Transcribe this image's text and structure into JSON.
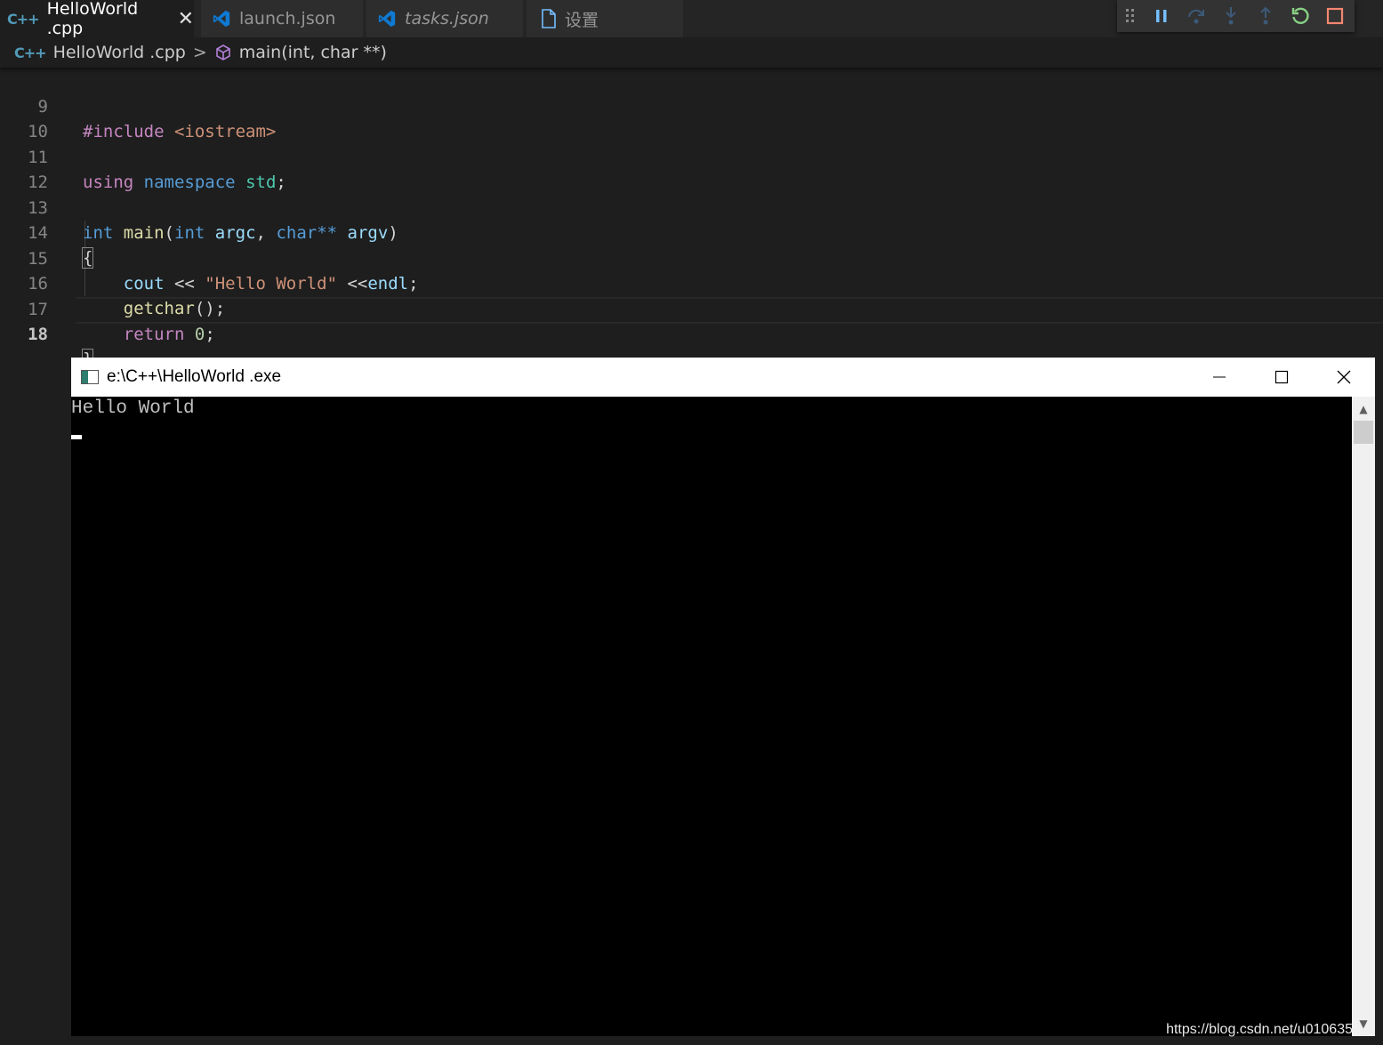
{
  "tabs": [
    {
      "label": "HelloWorld .cpp",
      "close": "✕"
    },
    {
      "label": "launch.json"
    },
    {
      "label": "tasks.json"
    },
    {
      "label": "设置"
    }
  ],
  "icons": {
    "cpp": "C++",
    "vs": "vscode-logo-icon",
    "file": "file-icon"
  },
  "debug_toolbar": [
    "drag-handle-icon",
    "pause-icon",
    "step-over-icon",
    "step-into-icon",
    "step-out-icon",
    "restart-icon",
    "stop-icon"
  ],
  "colors": {
    "accent": "#75beff",
    "restart": "#89d185",
    "stop": "#f48771"
  },
  "breadcrumb": {
    "file": "HelloWorld .cpp",
    "separator": ">",
    "symbol": "main(int, char **)"
  },
  "editor": {
    "line_numbers": [
      "9",
      "10",
      "11",
      "12",
      "13",
      "14",
      "15",
      "16",
      "17",
      "18"
    ],
    "current_line": "18"
  },
  "console": {
    "title": "e:\\C++\\HelloWorld .exe",
    "output": "Hello World",
    "controls": {
      "minimize": "—",
      "maximize": "☐",
      "close": "✕"
    }
  },
  "watermark": "https://blog.csdn.net/u010635"
}
